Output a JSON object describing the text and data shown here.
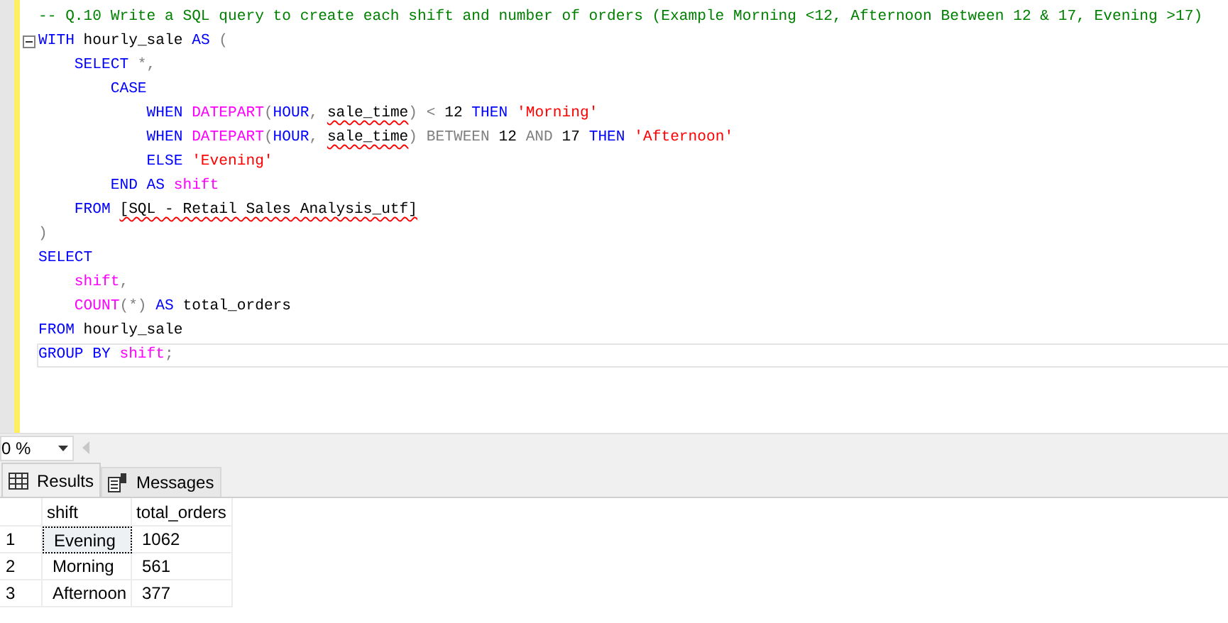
{
  "editor": {
    "lines": [
      {
        "tokens": [
          {
            "text": "-- Q.10 Write a SQL query to create each shift and number of orders (Example Morning <12, Afternoon Between 12 & 17, Evening >17)",
            "kind": "comment"
          }
        ]
      },
      {
        "collapsible": true,
        "tokens": [
          {
            "text": "WITH",
            "kind": "keyword"
          },
          {
            "text": " hourly_sale ",
            "kind": "plain"
          },
          {
            "text": "AS",
            "kind": "keyword"
          },
          {
            "text": " (",
            "kind": "operator"
          }
        ]
      },
      {
        "tokens": [
          {
            "text": "    SELECT",
            "kind": "keyword"
          },
          {
            "text": " *,",
            "kind": "operator"
          }
        ]
      },
      {
        "tokens": [
          {
            "text": "        CASE",
            "kind": "keyword"
          }
        ]
      },
      {
        "tokens": [
          {
            "text": "            WHEN ",
            "kind": "keyword"
          },
          {
            "text": "DATEPART",
            "kind": "function"
          },
          {
            "text": "(",
            "kind": "operator"
          },
          {
            "text": "HOUR",
            "kind": "keyword"
          },
          {
            "text": ", ",
            "kind": "operator"
          },
          {
            "text": "sale_time",
            "kind": "error"
          },
          {
            "text": ") < ",
            "kind": "operator"
          },
          {
            "text": "12",
            "kind": "plain"
          },
          {
            "text": " THEN ",
            "kind": "keyword"
          },
          {
            "text": "'Morning'",
            "kind": "string"
          }
        ]
      },
      {
        "tokens": [
          {
            "text": "            WHEN ",
            "kind": "keyword"
          },
          {
            "text": "DATEPART",
            "kind": "function"
          },
          {
            "text": "(",
            "kind": "operator"
          },
          {
            "text": "HOUR",
            "kind": "keyword"
          },
          {
            "text": ", ",
            "kind": "operator"
          },
          {
            "text": "sale_time",
            "kind": "error"
          },
          {
            "text": ") BETWEEN ",
            "kind": "operator"
          },
          {
            "text": "12",
            "kind": "plain"
          },
          {
            "text": " AND ",
            "kind": "operator"
          },
          {
            "text": "17",
            "kind": "plain"
          },
          {
            "text": " THEN ",
            "kind": "keyword"
          },
          {
            "text": "'Afternoon'",
            "kind": "string"
          }
        ]
      },
      {
        "tokens": [
          {
            "text": "            ELSE ",
            "kind": "keyword"
          },
          {
            "text": "'Evening'",
            "kind": "string"
          }
        ]
      },
      {
        "tokens": [
          {
            "text": "        END AS ",
            "kind": "keyword"
          },
          {
            "text": "shift",
            "kind": "function"
          }
        ]
      },
      {
        "tokens": [
          {
            "text": "    FROM ",
            "kind": "keyword"
          },
          {
            "text": "[SQL - Retail Sales Analysis_utf]",
            "kind": "error"
          }
        ]
      },
      {
        "tokens": [
          {
            "text": ")",
            "kind": "operator"
          }
        ]
      },
      {
        "tokens": [
          {
            "text": "SELECT",
            "kind": "keyword"
          }
        ]
      },
      {
        "tokens": [
          {
            "text": "    shift",
            "kind": "function"
          },
          {
            "text": ",",
            "kind": "operator"
          }
        ]
      },
      {
        "tokens": [
          {
            "text": "    COUNT",
            "kind": "function"
          },
          {
            "text": "(*) ",
            "kind": "operator"
          },
          {
            "text": "AS",
            "kind": "keyword"
          },
          {
            "text": " total_orders",
            "kind": "plain"
          }
        ]
      },
      {
        "tokens": [
          {
            "text": "FROM",
            "kind": "keyword"
          },
          {
            "text": " hourly_sale",
            "kind": "plain"
          }
        ]
      },
      {
        "current": true,
        "tokens": [
          {
            "text": "GROUP BY ",
            "kind": "keyword"
          },
          {
            "text": "shift",
            "kind": "function"
          },
          {
            "text": ";",
            "kind": "operator"
          }
        ]
      }
    ]
  },
  "zoom": {
    "value": "0 %"
  },
  "tabs": [
    {
      "label": "Results",
      "selected": true,
      "kind": "grid"
    },
    {
      "label": "Messages",
      "selected": false,
      "kind": "messages"
    }
  ],
  "results": {
    "columns": [
      "shift",
      "total_orders"
    ],
    "rows": [
      {
        "number": "1",
        "cells": [
          "Evening",
          "1062"
        ],
        "selected": true
      },
      {
        "number": "2",
        "cells": [
          "Morning",
          "561"
        ],
        "selected": false
      },
      {
        "number": "3",
        "cells": [
          "Afternoon",
          "377"
        ],
        "selected": false
      }
    ]
  }
}
